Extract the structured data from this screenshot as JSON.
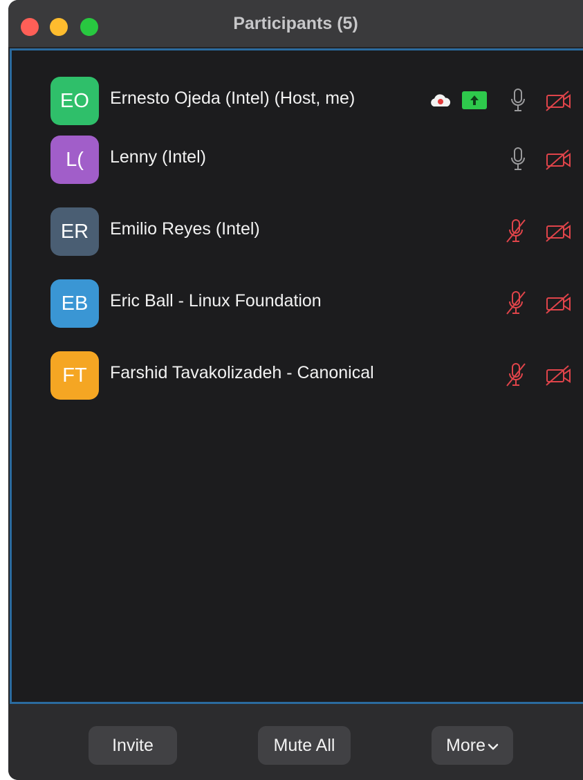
{
  "window": {
    "title": "Participants (5)"
  },
  "participants": [
    {
      "initials": "EO",
      "name": "Ernesto Ojeda (Intel) (Host, me)",
      "avatar_color": "#2fbf6a",
      "mic": "on",
      "video": "off",
      "recording_cloud": true,
      "sharing": true
    },
    {
      "initials": "L(",
      "name": "Lenny (Intel)",
      "avatar_color": "#a15ec9",
      "mic": "on",
      "video": "off"
    },
    {
      "initials": "ER",
      "name": "Emilio Reyes (Intel)",
      "avatar_color": "#4a5e73",
      "mic": "muted",
      "video": "off"
    },
    {
      "initials": "EB",
      "name": "Eric Ball - Linux Foundation",
      "avatar_color": "#3a96d4",
      "mic": "muted",
      "video": "off"
    },
    {
      "initials": "FT",
      "name": "Farshid Tavakolizadeh - Canonical",
      "avatar_color": "#f5a623",
      "mic": "muted",
      "video": "off"
    }
  ],
  "footer": {
    "invite_label": "Invite",
    "mute_all_label": "Mute All",
    "more_label": "More"
  },
  "colors": {
    "accent_border": "#2b6b9f",
    "muted_red": "#e0444a",
    "share_green": "#2ec94c"
  }
}
